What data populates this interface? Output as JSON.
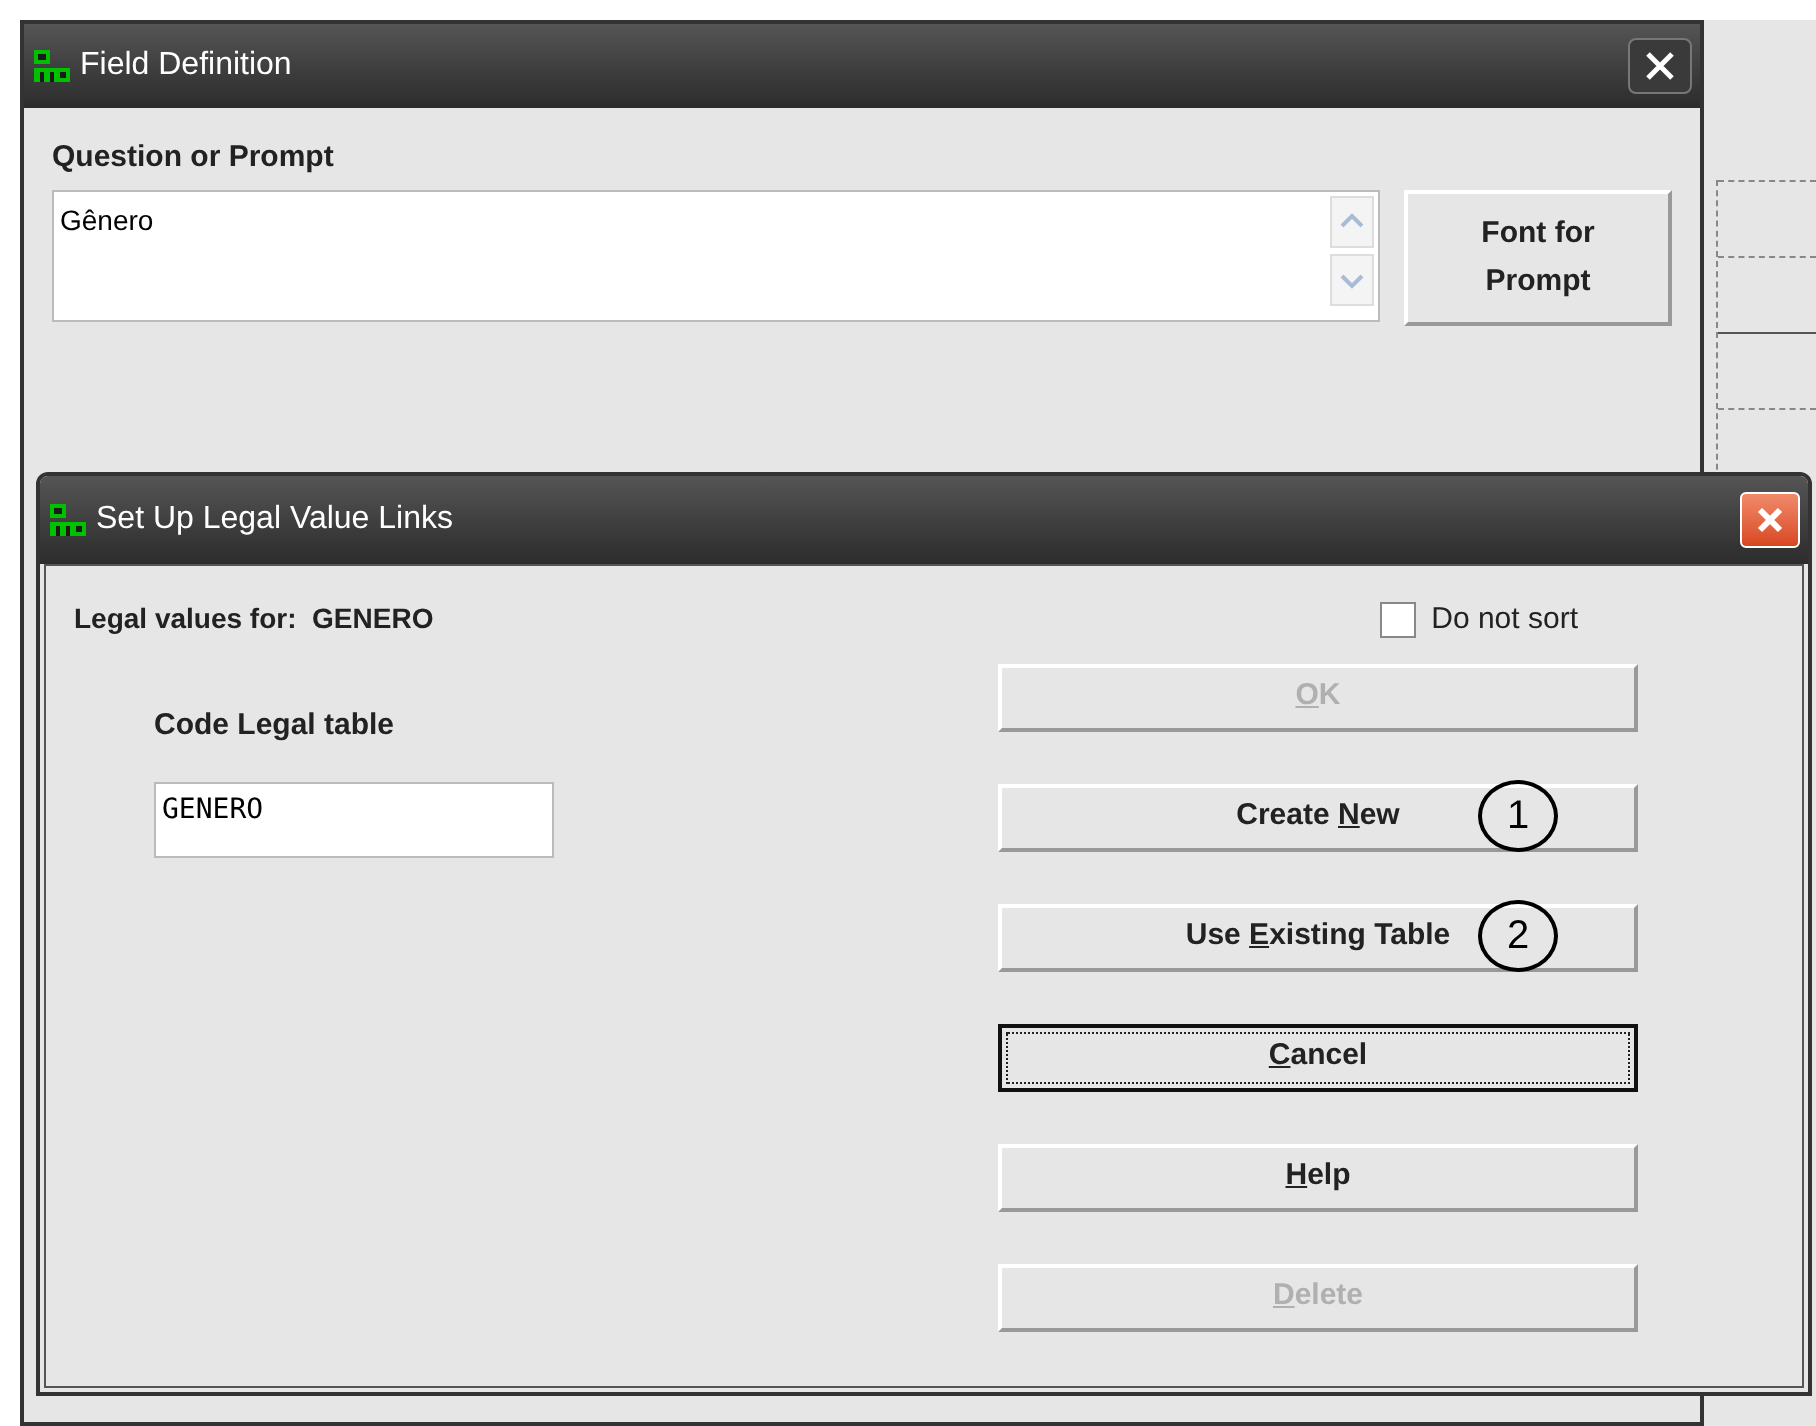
{
  "field_window": {
    "title": "Field Definition",
    "prompt_label": "Question or Prompt",
    "prompt_value": "Gênero",
    "font_button": "Font for Prompt"
  },
  "dialog": {
    "title": "Set Up Legal Value Links",
    "legal_values_label": "Legal values for:  GENERO",
    "do_not_sort": {
      "label": "Do not sort",
      "checked": false
    },
    "code_label": "Code Legal table",
    "code_value": "GENERO",
    "buttons": [
      {
        "key": "O",
        "after": "K",
        "disabled": true,
        "focused": false
      },
      {
        "before": "Create ",
        "key": "N",
        "after": "ew",
        "disabled": false,
        "focused": false,
        "annotation": "1"
      },
      {
        "before": "Use ",
        "key": "E",
        "after": "xisting Table",
        "disabled": false,
        "focused": false,
        "annotation": "2"
      },
      {
        "key": "C",
        "after": "ancel",
        "disabled": false,
        "focused": true
      },
      {
        "key": "H",
        "after": "elp",
        "disabled": false,
        "focused": false
      },
      {
        "key": "D",
        "after": "elete",
        "disabled": true,
        "focused": false
      }
    ]
  }
}
